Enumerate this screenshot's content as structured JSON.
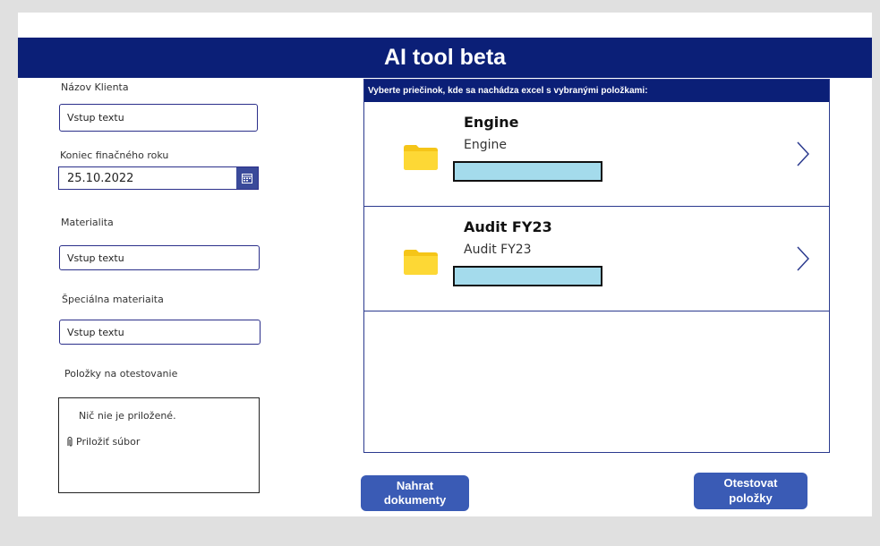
{
  "app": {
    "title": "AI tool beta"
  },
  "form": {
    "client_name": {
      "label": "Názov Klienta",
      "value": "Vstup textu"
    },
    "fiscal_end": {
      "label": "Koniec finačného roku",
      "value": "25.10.2022"
    },
    "materiality": {
      "label": "Materialita",
      "value": "Vstup textu"
    },
    "special_materiality": {
      "label": "Špeciálna materiaita",
      "value": "Vstup textu"
    },
    "test_items": {
      "label": "Položky na otestovanie",
      "empty_text": "Nič nie je priložené.",
      "attach_label": "Priložiť súbor"
    }
  },
  "folders": {
    "title": "Vyberte priečinok, kde sa nachádza excel s vybranými položkami:",
    "items": [
      {
        "title": "Engine",
        "subtitle": "Engine"
      },
      {
        "title": "Audit FY23",
        "subtitle": "Audit FY23"
      }
    ]
  },
  "buttons": {
    "upload_line1": "Nahrat",
    "upload_line2": "dokumenty",
    "test_line1": "Otestovat",
    "test_line2": "položky"
  },
  "colors": {
    "header": "#0b1f77",
    "button": "#3a5bb5",
    "folder": "#f5c518",
    "bar": "#a4dbec"
  },
  "icons": [
    "calendar-icon",
    "folder-icon",
    "chevron-right-icon",
    "paperclip-icon"
  ]
}
